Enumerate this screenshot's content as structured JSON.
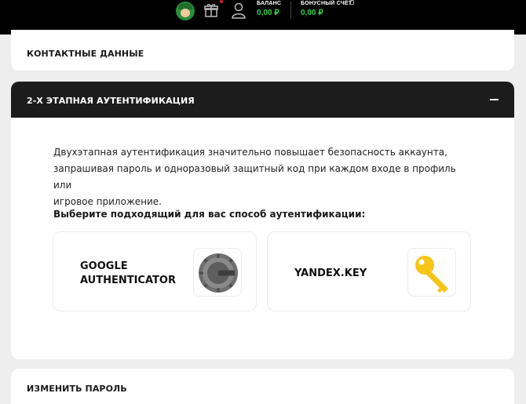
{
  "header": {
    "balance_label": "БАЛАНС",
    "balance_value": "0,00 ₽",
    "bonus_label": "БОНУСНЫЙ СЧЁТ",
    "bonus_value": "0,00 ₽",
    "icons": [
      "mascot-avatar",
      "gift-icon",
      "user-icon",
      "bonus-info-icon"
    ],
    "accent_color": "#3cd050"
  },
  "sections": {
    "contacts": {
      "title": "КОНТАКТНЫЕ ДАННЫЕ"
    },
    "twofa": {
      "title": "2-Х ЭТАПНАЯ АУТЕНТИФИКАЦИЯ",
      "collapse_icon": "minus-icon",
      "description_line1": "Двухэтапная аутентификация значительно повышает безопасность аккаунта,",
      "description_line2": "запрашивая пароль и одноразовый защитный код при каждом входе в профиль или",
      "description_line3": "игровое приложение.",
      "choose_label": "Выберите подходящий для вас способ аутентификации:",
      "methods": [
        {
          "name_line1": "GOOGLE",
          "name_line2": "AUTHENTICATOR",
          "icon": "google-authenticator-logo"
        },
        {
          "name": "YANDEX.KEY",
          "icon": "yandex-key-logo",
          "color": "#f5c518"
        }
      ]
    },
    "password": {
      "title": "ИЗМЕНИТЬ ПАРОЛЬ"
    }
  }
}
